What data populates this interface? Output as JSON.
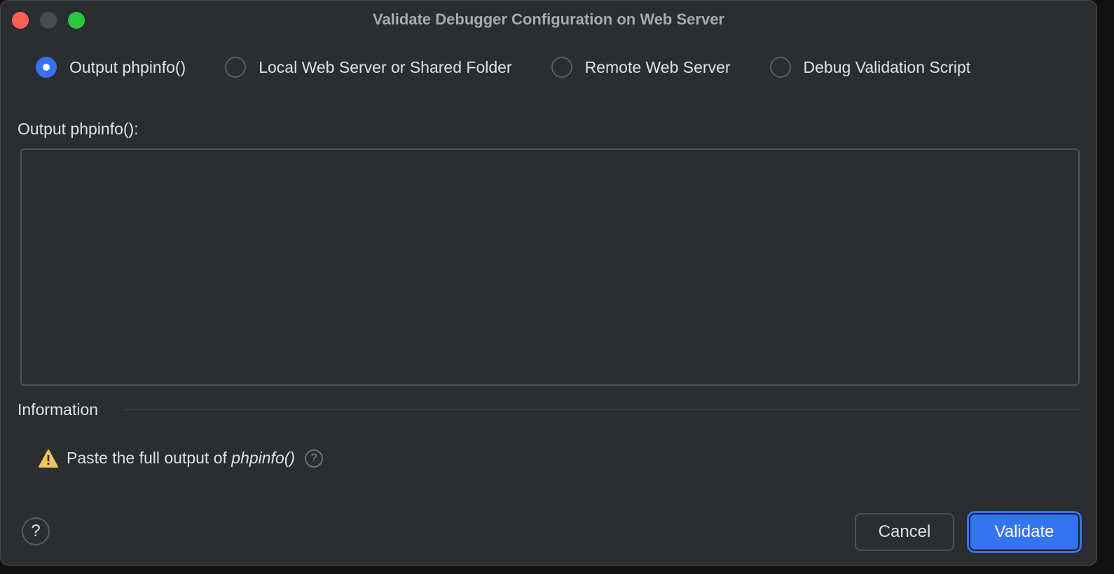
{
  "window": {
    "title": "Validate Debugger Configuration on Web Server"
  },
  "radios": [
    {
      "label": "Output phpinfo()",
      "selected": true
    },
    {
      "label": "Local Web Server or Shared Folder",
      "selected": false
    },
    {
      "label": "Remote Web Server",
      "selected": false
    },
    {
      "label": "Debug Validation Script",
      "selected": false
    }
  ],
  "output_label": "Output phpinfo():",
  "output_value": "",
  "information": {
    "heading": "Information",
    "message": "Paste the full output of ",
    "message_em": "phpinfo()"
  },
  "buttons": {
    "help": "?",
    "cancel": "Cancel",
    "validate": "Validate"
  },
  "colors": {
    "accent": "#3574f0",
    "close": "#ff5f57",
    "minimize": "#4a4b4e",
    "zoom": "#28c840",
    "warning": "#f2c55c"
  }
}
